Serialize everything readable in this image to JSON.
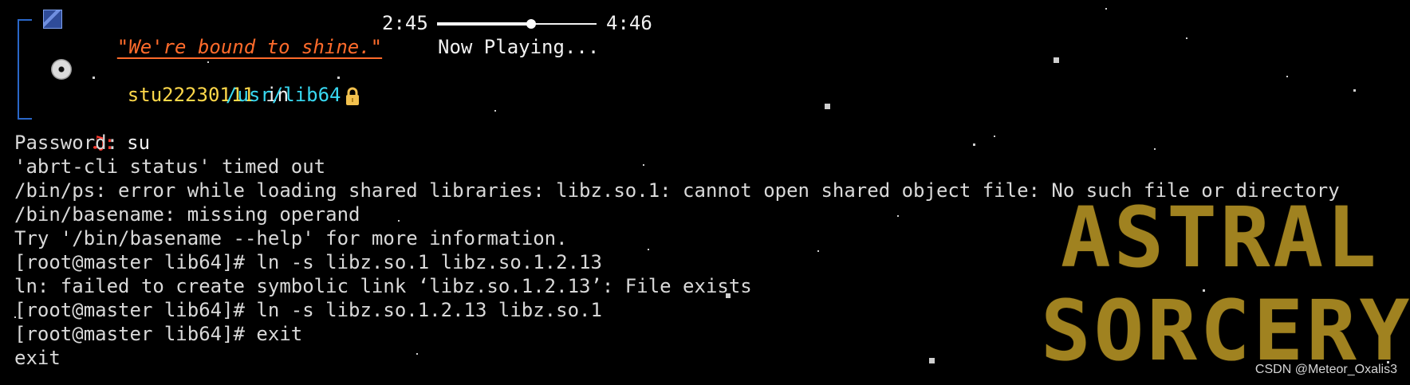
{
  "status_bar": {
    "quote": "\"We're bound to shine.\"",
    "player": {
      "elapsed": "2:45",
      "total": "4:46",
      "progress": 0.59,
      "status": "Now Playing..."
    }
  },
  "prompt": {
    "user": "stu22230111",
    "connector": "in",
    "path": "/usr/lib64",
    "symbol": "♫:",
    "command": "su"
  },
  "terminal": {
    "lines": [
      "Password:",
      "'abrt-cli status' timed out",
      "/bin/ps: error while loading shared libraries: libz.so.1: cannot open shared object file: No such file or directory",
      "/bin/basename: missing operand",
      "Try '/bin/basename --help' for more information.",
      "[root@master lib64]# ln -s libz.so.1 libz.so.1.2.13",
      "ln: failed to create symbolic link ‘libz.so.1.2.13’: File exists",
      "[root@master lib64]# ln -s libz.so.1.2.13 libz.so.1",
      "[root@master lib64]# exit",
      "exit"
    ]
  },
  "watermark": {
    "line1": "ASTRAL",
    "line2": "SORCERY"
  },
  "credit": "CSDN @Meteor_Oxalis3",
  "colors": {
    "background": "#000000",
    "quote": "#ff6b2b",
    "username": "#ffd84a",
    "path": "#38d9f2",
    "accent": "#a08220",
    "icon_red": "#ff3b30",
    "frame": "#2a67c8"
  },
  "icons": {
    "status_badge": "space-badge-icon",
    "disc": "disc-icon",
    "lock": "lock-icon",
    "music": "music-note-icon"
  }
}
